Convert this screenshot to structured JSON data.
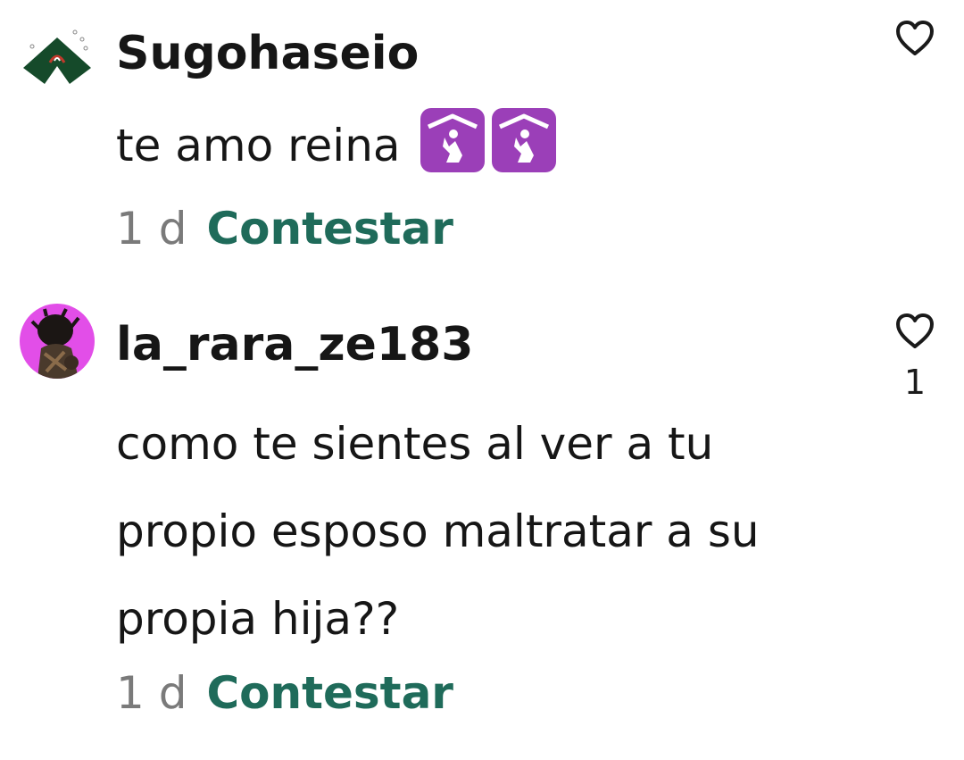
{
  "comments": [
    {
      "username": "Sugohaseio",
      "text_before_emoji": "te amo reina",
      "emoji": [
        "place-of-worship-emoji",
        "place-of-worship-emoji"
      ],
      "time": "1 d",
      "reply_label": "Contestar",
      "like_count": ""
    },
    {
      "username": "la_rara_ze183",
      "text_lines": [
        "como te sientes al ver a tu",
        "propio esposo maltratar a su",
        "propia hija??"
      ],
      "time": "1 d",
      "reply_label": "Contestar",
      "like_count": "1"
    }
  ],
  "colors": {
    "reply": "#1f6b5a",
    "time": "#7a7a7a",
    "emoji_bg": "#9b3fb8"
  }
}
